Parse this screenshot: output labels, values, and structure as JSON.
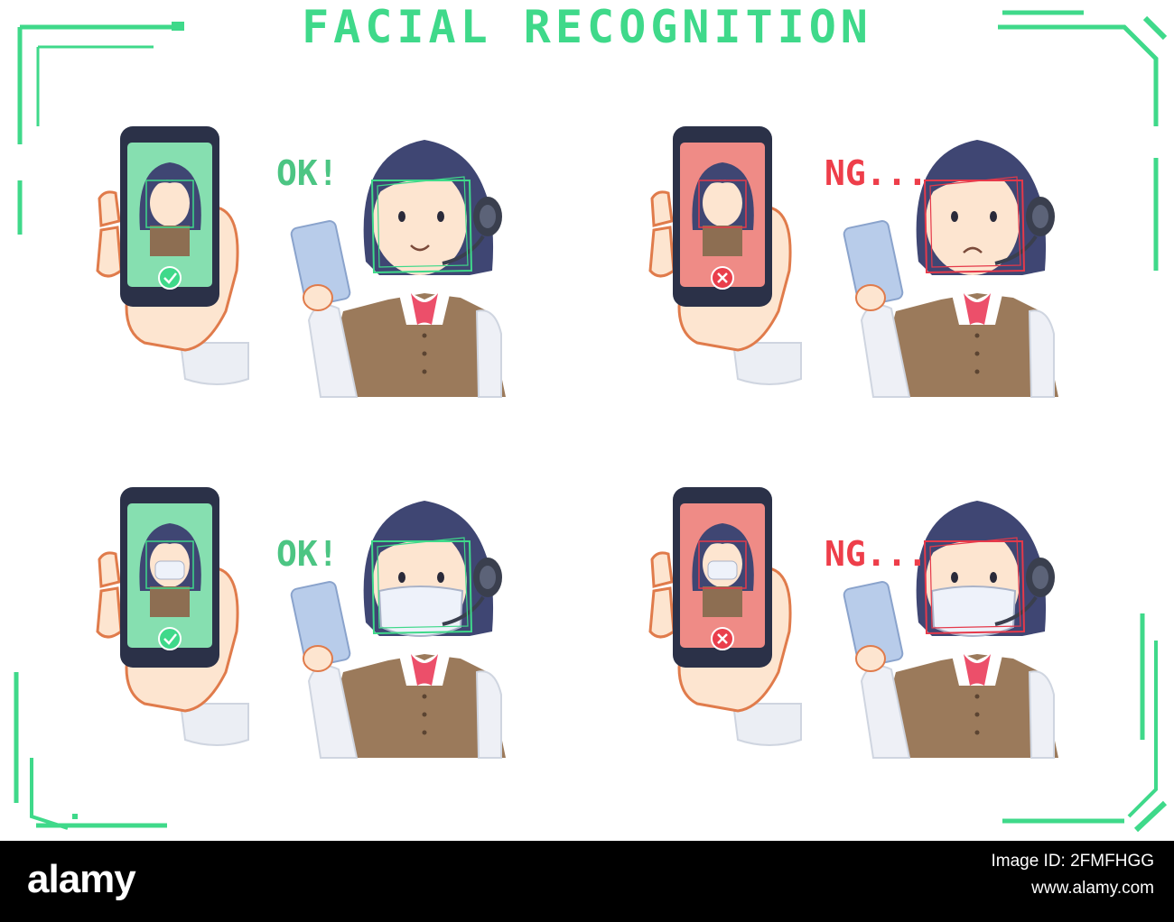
{
  "title": "FACIAL RECOGNITION",
  "panels": [
    {
      "verdict": "OK!",
      "status": "success",
      "mask": false
    },
    {
      "verdict": "NG...",
      "status": "failure",
      "mask": false
    },
    {
      "verdict": "OK!",
      "status": "success",
      "mask": true
    },
    {
      "verdict": "NG...",
      "status": "failure",
      "mask": true
    }
  ],
  "footer": {
    "logo": "alamy",
    "image_id": "Image ID: 2FMFHGG",
    "url": "www.alamy.com"
  },
  "colors": {
    "accent_green": "#3fd98a",
    "ok_text": "#4cc583",
    "ng_text": "#ee3e4a",
    "success_screen": "#86dfb0",
    "failure_screen": "#ef8b86",
    "hair": "#3f4673",
    "vest": "#9b7a5b",
    "skin": "#fde5d0",
    "phone_body": "#2b3148",
    "footer_bg": "#000000"
  },
  "icons": [
    "check-icon",
    "cross-icon",
    "headset-icon",
    "phone-icon",
    "hand-icon",
    "mask-icon"
  ]
}
